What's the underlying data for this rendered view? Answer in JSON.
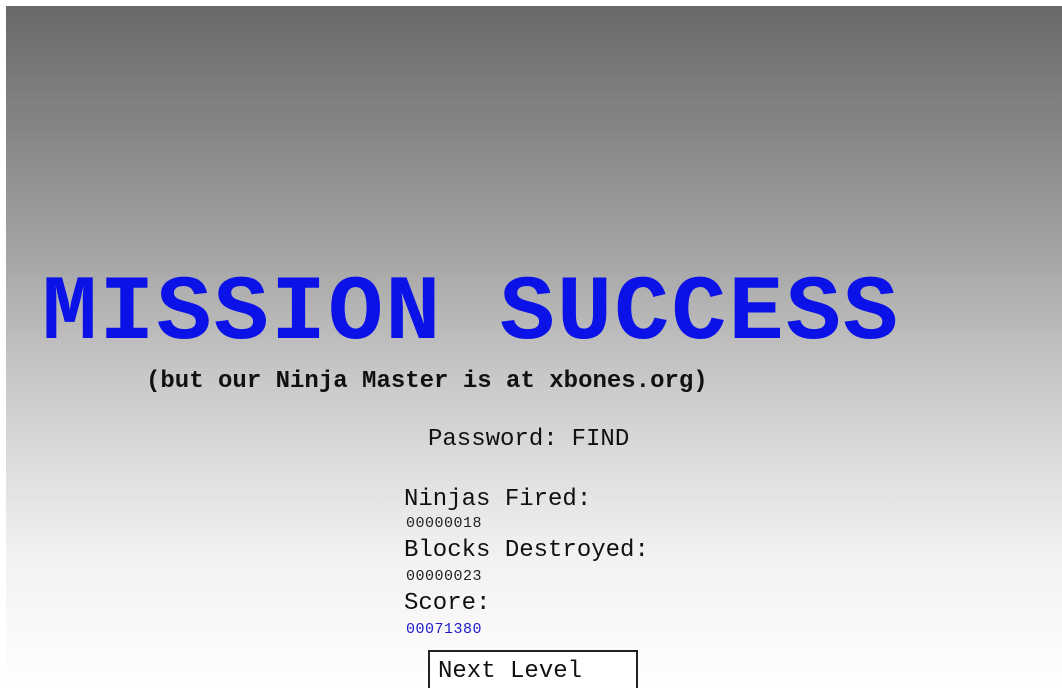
{
  "title": "MISSION SUCCESS",
  "subtitle": "(but our Ninja Master is at xbones.org)",
  "password": {
    "label": "Password:",
    "value": "FIND"
  },
  "stats": {
    "ninjas_fired": {
      "label": "Ninjas Fired:",
      "value": "00000018"
    },
    "blocks_destroyed": {
      "label": "Blocks Destroyed:",
      "value": "00000023"
    },
    "score": {
      "label": "Score:",
      "value": "00071380"
    }
  },
  "next_button": {
    "label": "Next Level"
  },
  "colors": {
    "title": "#0b12e8",
    "score_value": "#1c1ccc",
    "gradient_top": "#686868",
    "gradient_bottom": "#ffffff"
  }
}
